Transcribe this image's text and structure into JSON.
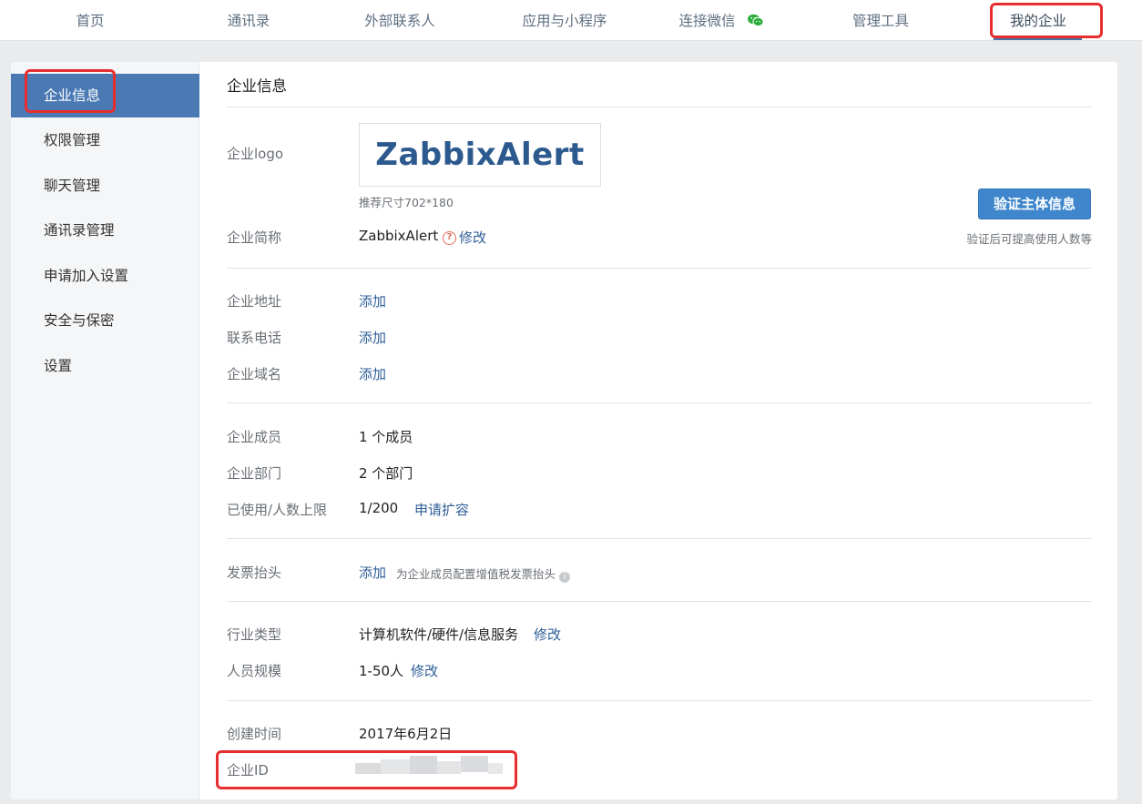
{
  "nav": {
    "items": [
      {
        "label": "首页"
      },
      {
        "label": "通讯录"
      },
      {
        "label": "外部联系人"
      },
      {
        "label": "应用与小程序"
      },
      {
        "label": "连接微信"
      },
      {
        "label": "管理工具"
      },
      {
        "label": "我的企业"
      }
    ],
    "active_index": 6
  },
  "sidebar": {
    "items": [
      {
        "label": "企业信息"
      },
      {
        "label": "权限管理"
      },
      {
        "label": "聊天管理"
      },
      {
        "label": "通讯录管理"
      },
      {
        "label": "申请加入设置"
      },
      {
        "label": "安全与保密"
      },
      {
        "label": "设置"
      }
    ],
    "active_index": 0
  },
  "content": {
    "title": "企业信息",
    "logo": {
      "label": "企业logo",
      "image_text": "ZabbixAlert",
      "size_hint": "推荐尺寸702*180"
    },
    "verify": {
      "button_label": "验证主体信息",
      "note": "验证后可提高使用人数等"
    },
    "short_name": {
      "label": "企业简称",
      "value": "ZabbixAlert",
      "help_icon": "?",
      "action": "修改"
    },
    "address": {
      "label": "企业地址",
      "action": "添加"
    },
    "phone": {
      "label": "联系电话",
      "action": "添加"
    },
    "domain": {
      "label": "企业域名",
      "action": "添加"
    },
    "members": {
      "label": "企业成员",
      "value": "1 个成员"
    },
    "departments": {
      "label": "企业部门",
      "value": "2 个部门"
    },
    "limit": {
      "label": "已使用/人数上限",
      "value": "1/200",
      "action": "申请扩容"
    },
    "invoice": {
      "label": "发票抬头",
      "action": "添加",
      "note": "为企业成员配置增值税发票抬头",
      "info_icon": "i"
    },
    "industry": {
      "label": "行业类型",
      "value": "计算机软件/硬件/信息服务",
      "action": "修改"
    },
    "scale": {
      "label": "人员规模",
      "value": "1-50人",
      "action": "修改"
    },
    "created": {
      "label": "创建时间",
      "value": "2017年6月2日"
    },
    "corp_id": {
      "label": "企业ID"
    }
  },
  "colors": {
    "accent": "#4a79b4",
    "link": "#2e5e97",
    "highlight": "#e62e2e",
    "button": "#3f86cc"
  },
  "icons": {
    "wechat": "wechat-icon",
    "help": "question-icon",
    "info": "info-icon"
  }
}
